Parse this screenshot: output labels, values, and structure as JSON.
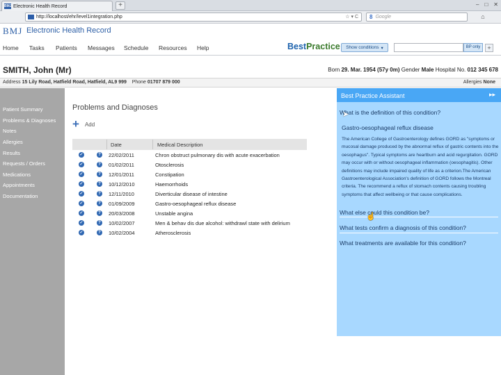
{
  "browser": {
    "tab_title": "Electronic Health Record",
    "new_tab": "+",
    "url": "http://localhost/ehr/level1integration.php",
    "url_tools": "☆ ▾ C",
    "search_engine": "8",
    "search_placeholder": "Google",
    "window_controls": [
      "–",
      "□",
      "✕"
    ]
  },
  "app": {
    "logo": "BMJ",
    "title": "Electronic Health Record"
  },
  "menu": [
    "Home",
    "Tasks",
    "Patients",
    "Messages",
    "Schedule",
    "Resources",
    "Help"
  ],
  "best_practice": {
    "logo_part1": "Best",
    "logo_part2": "Practice",
    "show_conditions": "Show conditions",
    "bp_only": "BP only",
    "plus": "+"
  },
  "patient": {
    "name": "SMITH, John (Mr)",
    "born_label": "Born",
    "born": "29. Mar. 1954 (57y 0m)",
    "gender_label": "Gender",
    "gender": "Male",
    "hospital_label": "Hospital No.",
    "hospital_no": "012 345 678",
    "address_label": "Address",
    "address": "15 Lily Road, Hatfield Road, Hatfield, AL9 999",
    "phone_label": "Phone",
    "phone": "01707 879 000",
    "allergies_label": "Allergies",
    "allergies": "None"
  },
  "sidebar": [
    "Patient Summary",
    "Problems & Diagnoses",
    "Notes",
    "Allergies",
    "Results",
    "Requests / Orders",
    "Medications",
    "Appointments",
    "Documentation"
  ],
  "main": {
    "title": "Problems and Diagnoses",
    "add_label": "Add",
    "columns": [
      "Date",
      "Medical Description"
    ],
    "rows": [
      {
        "date": "22/02/2011",
        "desc": "Chron obstruct pulmonary dis with acute exacerbation"
      },
      {
        "date": "01/02/2011",
        "desc": "Otosclerosis"
      },
      {
        "date": "12/01/2011",
        "desc": "Constipation"
      },
      {
        "date": "10/12/2010",
        "desc": "Haemorrhoids"
      },
      {
        "date": "12/11/2010",
        "desc": "Diverticular disease of intestine"
      },
      {
        "date": "01/09/2009",
        "desc": "Gastro-oesophageal reflux disease"
      },
      {
        "date": "20/03/2008",
        "desc": "Unstable angina"
      },
      {
        "date": "10/02/2007",
        "desc": "Men & behav dis due alcohol: withdrawl state with delirium"
      },
      {
        "date": "10/02/2004",
        "desc": "Atherosclerosis"
      }
    ]
  },
  "assistant": {
    "title": "Best Practice Assistant",
    "collapse": "▸▸",
    "q1": "What is the definition of this condition?",
    "answer_title": "Gastro-oesophageal reflux disease",
    "answer_text": "The American College of Gastroenterology defines GORD as \"symptoms or mucosal damage produced by the abnormal reflux of gastric contents into the oesophagus\". Typical symptoms are heartburn and acid regurgitation. GORD may occur with or without oesophageal inflammation (oesophagitis). Other definitions may include impaired quality of life as a criterion.The American Gastroenterological Association's definition of GORD follows the Montreal criteria. The recommend a reflux of stomach contents causing troubling symptoms that affect wellbeing or that cause complications.",
    "q2": "What else could this condition be?",
    "q3": "What tests confirm a diagnosis of this condition?",
    "q4": "What treatments are available for this condition?"
  }
}
